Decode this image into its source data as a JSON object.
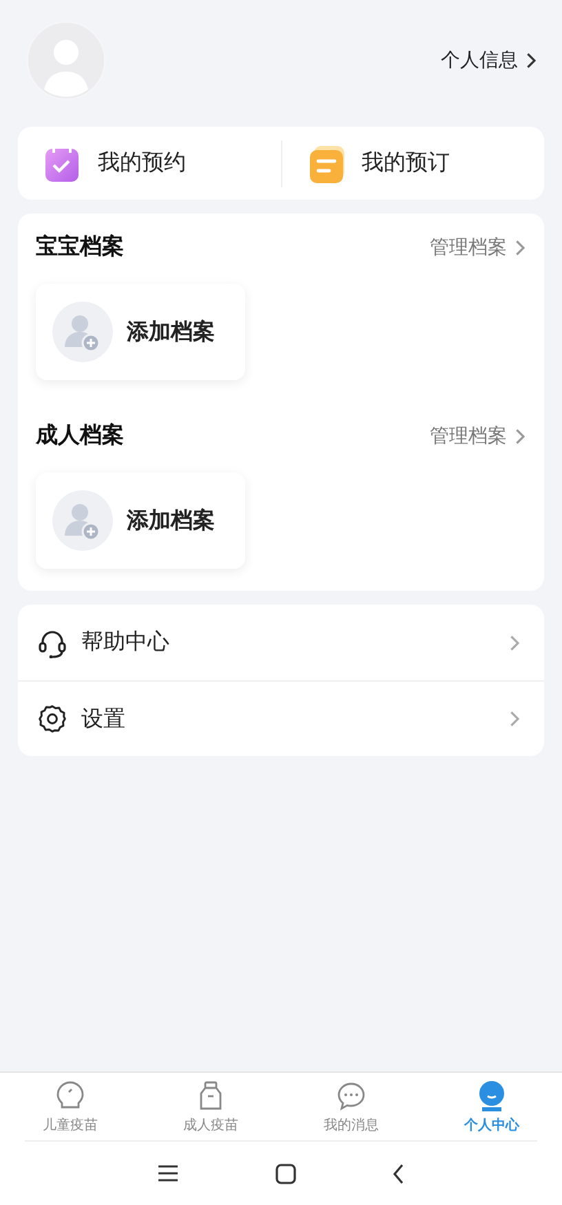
{
  "header": {
    "profile_link": "个人信息"
  },
  "shortcuts": [
    {
      "kind": "appointment",
      "label": "我的预约"
    },
    {
      "kind": "order",
      "label": "我的预订"
    }
  ],
  "archives": [
    {
      "title": "宝宝档案",
      "manage": "管理档案",
      "add": "添加档案"
    },
    {
      "title": "成人档案",
      "manage": "管理档案",
      "add": "添加档案"
    }
  ],
  "menu": [
    {
      "kind": "help",
      "label": "帮助中心"
    },
    {
      "kind": "settings",
      "label": "设置"
    }
  ],
  "tab_bar": [
    {
      "kind": "child",
      "label": "儿童疫苗",
      "selected": false
    },
    {
      "kind": "adult",
      "label": "成人疫苗",
      "selected": false
    },
    {
      "kind": "message",
      "label": "我的消息",
      "selected": false
    },
    {
      "kind": "profile",
      "label": "个人中心",
      "selected": true
    }
  ]
}
